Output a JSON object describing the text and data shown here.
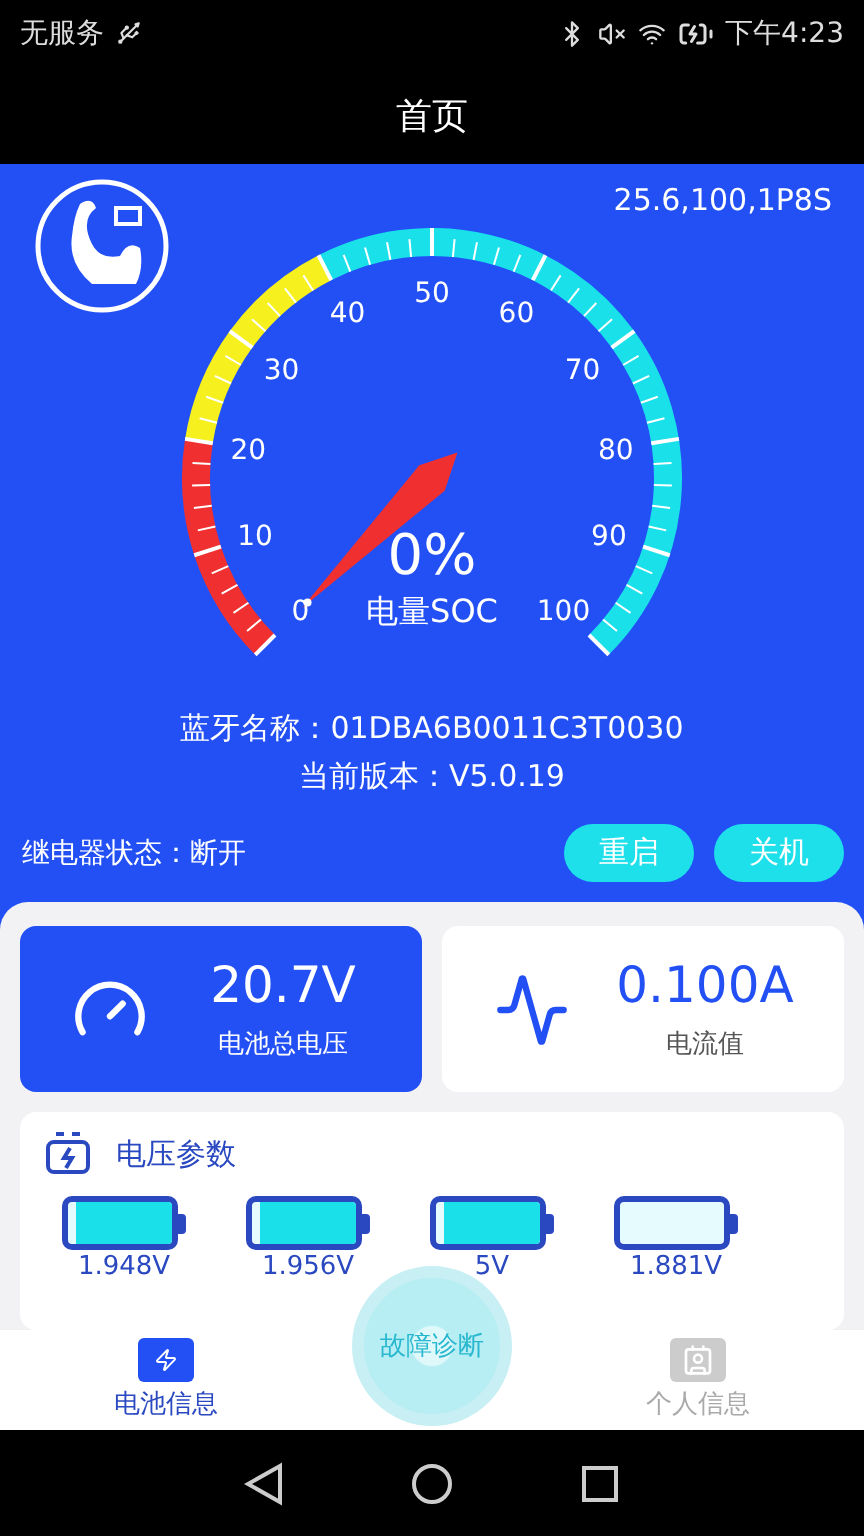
{
  "status_bar": {
    "carrier": "无服务",
    "time": "下午4:23"
  },
  "header": {
    "title": "首页"
  },
  "device": {
    "config": "25.6,100,1P8S"
  },
  "gauge": {
    "level": 0,
    "reading": "0%",
    "label": "电量SOC",
    "ticks": [
      "0",
      "10",
      "20",
      "30",
      "40",
      "50",
      "60",
      "70",
      "80",
      "90",
      "100"
    ]
  },
  "info": {
    "bluetooth": "蓝牙名称：01DBA6B0011C3T0030",
    "version": "当前版本：V5.0.19"
  },
  "relay": {
    "status": "继电器状态：断开",
    "buttons": [
      "重启",
      "关机"
    ]
  },
  "stats": [
    {
      "kind": "voltage",
      "value": "20.7V",
      "label": "电池总电压",
      "selected": true
    },
    {
      "kind": "current",
      "value": "0.100A",
      "label": "电流值",
      "selected": false
    }
  ],
  "voltage_params": {
    "title": "电压参数",
    "cells": [
      {
        "level": 0.93,
        "reading": "1.948V"
      },
      {
        "level": 0.93,
        "reading": "1.956V"
      },
      {
        "level": 0.93,
        "reading": "5V"
      },
      {
        "level": 0,
        "reading": "1.881V"
      }
    ]
  },
  "nav": {
    "center": "故障诊断",
    "tabs": [
      {
        "kind": "battery",
        "label": "电池信息",
        "selected": true
      },
      {
        "kind": "profile",
        "label": "个人信息",
        "selected": false
      }
    ]
  }
}
